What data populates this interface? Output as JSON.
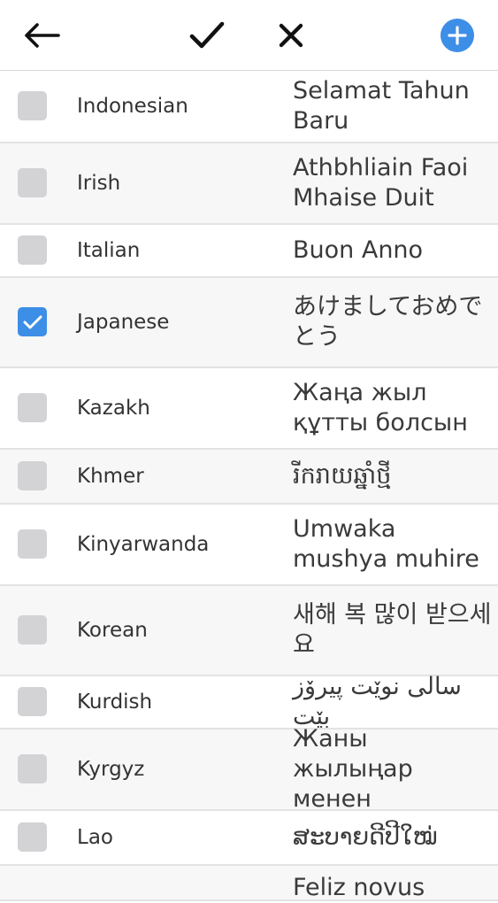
{
  "toolbar": {
    "back_icon": "arrow-left-icon",
    "confirm_icon": "checkmark-icon",
    "cancel_icon": "close-icon",
    "add_icon": "plus-circle-icon",
    "accent_color": "#3d8ee6"
  },
  "languages": [
    {
      "name": "Indonesian",
      "greeting": "Selamat Tahun Baru",
      "checked": false
    },
    {
      "name": "Irish",
      "greeting": "Athbhliain Faoi Mhaise Duit",
      "checked": false
    },
    {
      "name": "Italian",
      "greeting": "Buon Anno",
      "checked": false
    },
    {
      "name": "Japanese",
      "greeting": "あけましておめでとう",
      "checked": true
    },
    {
      "name": "Kazakh",
      "greeting": "Жаңа жыл құтты болсын",
      "checked": false
    },
    {
      "name": "Khmer",
      "greeting": "រីករាយឆ្នាំថ្មី",
      "checked": false
    },
    {
      "name": "Kinyarwanda",
      "greeting": "Umwaka mushya muhire",
      "checked": false
    },
    {
      "name": "Korean",
      "greeting": "새해 복 많이 받으세요",
      "checked": false
    },
    {
      "name": "Kurdish",
      "greeting": "سالی نوێت پیرۆز بێت",
      "checked": false
    },
    {
      "name": "Kyrgyz",
      "greeting": "Жаны жылыңар менен",
      "checked": false
    },
    {
      "name": "Lao",
      "greeting": "ສະບາຍດີປີໃໝ່",
      "checked": false
    },
    {
      "name": "",
      "greeting": "Feliz novus",
      "checked": false
    }
  ]
}
